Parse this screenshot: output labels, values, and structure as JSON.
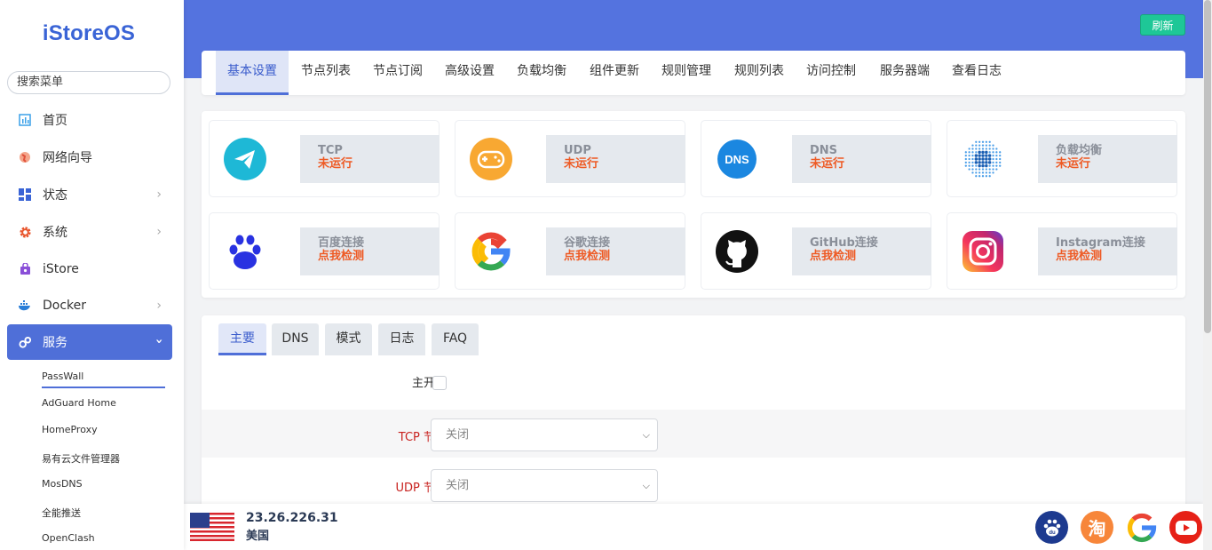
{
  "sidebar": {
    "logo": "iStoreOS",
    "search_placeholder": "搜索菜单",
    "items": [
      {
        "label": "首页",
        "icon": "dashboard-icon"
      },
      {
        "label": "网络向导",
        "icon": "globe-icon"
      },
      {
        "label": "状态",
        "icon": "grid-icon"
      },
      {
        "label": "系统",
        "icon": "gear-icon"
      },
      {
        "label": "iStore",
        "icon": "store-bag-icon"
      },
      {
        "label": "Docker",
        "icon": "docker-whale-icon"
      },
      {
        "label": "服务",
        "icon": "services-gears-icon"
      }
    ],
    "sub_items": [
      "PassWall",
      "AdGuard Home",
      "HomeProxy",
      "易有云文件管理器",
      "MosDNS",
      "全能推送",
      "OpenClash"
    ]
  },
  "header": {
    "refresh_label": "刷新"
  },
  "tabs": [
    "基本设置",
    "节点列表",
    "节点订阅",
    "高级设置",
    "负载均衡",
    "组件更新",
    "规则管理",
    "规则列表",
    "访问控制",
    "服务器端",
    "查看日志"
  ],
  "status_tiles": [
    {
      "name": "TCP",
      "status": "未运行",
      "icon": "telegram-plane-icon"
    },
    {
      "name": "UDP",
      "status": "未运行",
      "icon": "gamepad-icon"
    },
    {
      "name": "DNS",
      "status": "未运行",
      "icon": "dns-globe-icon",
      "icon_text": "DNS"
    },
    {
      "name": "负载均衡",
      "status": "未运行",
      "icon": "load-balance-dots-icon"
    },
    {
      "name": "百度连接",
      "status": "点我检测",
      "icon": "baidu-paw-icon"
    },
    {
      "name": "谷歌连接",
      "status": "点我检测",
      "icon": "google-g-icon"
    },
    {
      "name": "GitHub连接",
      "status": "点我检测",
      "icon": "github-icon"
    },
    {
      "name": "Instagram连接",
      "status": "点我检测",
      "icon": "instagram-icon"
    }
  ],
  "subtabs": [
    "主要",
    "DNS",
    "模式",
    "日志",
    "FAQ"
  ],
  "form": {
    "main_switch_label": "主开关",
    "tcp_node_label": "TCP 节点",
    "tcp_node_value": "关闭",
    "udp_node_label": "UDP 节点",
    "udp_node_value": "关闭"
  },
  "footer": {
    "ip": "23.26.226.31",
    "country": "美国",
    "flag_icon": "us-flag-icon",
    "sites": [
      {
        "icon": "baidu-icon",
        "text": "du"
      },
      {
        "icon": "taobao-icon",
        "text": "淘"
      },
      {
        "icon": "google-icon",
        "text": "G"
      },
      {
        "icon": "youtube-icon",
        "text": ""
      }
    ]
  },
  "colors": {
    "accent": "#4f6fd8",
    "header_blue": "#5473df",
    "refresh_green": "#1ec797",
    "status_orange": "#ee5a24"
  }
}
